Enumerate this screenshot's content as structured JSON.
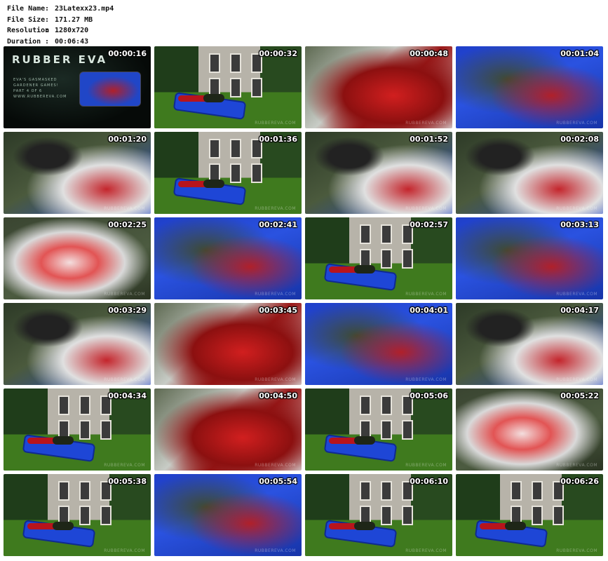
{
  "file_info": [
    {
      "key": "File Name",
      "value": "23Latexx23.mp4"
    },
    {
      "key": "File Size",
      "value": "171.27 MB"
    },
    {
      "key": "Resolution",
      "value": "1280x720"
    },
    {
      "key": "Duration",
      "value": "00:06:43"
    }
  ],
  "title_card": {
    "brand": "RUBBER EVA",
    "subtitle_line1": "EVA'S GASMASKED",
    "subtitle_line2": "GARDENER GAMES!",
    "part": "PART 4 OF 6",
    "site": "WWW.RUBBEREVA.COM"
  },
  "watermark": "RUBBEREVA.COM",
  "thumbnails": [
    {
      "time": "00:00:16",
      "scene": "title"
    },
    {
      "time": "00:00:32",
      "scene": "garden"
    },
    {
      "time": "00:00:48",
      "scene": "closeup-red"
    },
    {
      "time": "00:01:04",
      "scene": "mattress"
    },
    {
      "time": "00:01:20",
      "scene": "mask"
    },
    {
      "time": "00:01:36",
      "scene": "garden"
    },
    {
      "time": "00:01:52",
      "scene": "mask"
    },
    {
      "time": "00:02:08",
      "scene": "mask"
    },
    {
      "time": "00:02:25",
      "scene": "bag"
    },
    {
      "time": "00:02:41",
      "scene": "mattress"
    },
    {
      "time": "00:02:57",
      "scene": "garden"
    },
    {
      "time": "00:03:13",
      "scene": "mattress"
    },
    {
      "time": "00:03:29",
      "scene": "mask"
    },
    {
      "time": "00:03:45",
      "scene": "closeup-red"
    },
    {
      "time": "00:04:01",
      "scene": "mattress"
    },
    {
      "time": "00:04:17",
      "scene": "mask"
    },
    {
      "time": "00:04:34",
      "scene": "garden"
    },
    {
      "time": "00:04:50",
      "scene": "closeup-red"
    },
    {
      "time": "00:05:06",
      "scene": "garden"
    },
    {
      "time": "00:05:22",
      "scene": "bag"
    },
    {
      "time": "00:05:38",
      "scene": "garden"
    },
    {
      "time": "00:05:54",
      "scene": "mattress"
    },
    {
      "time": "00:06:10",
      "scene": "garden"
    },
    {
      "time": "00:06:26",
      "scene": "garden"
    }
  ]
}
